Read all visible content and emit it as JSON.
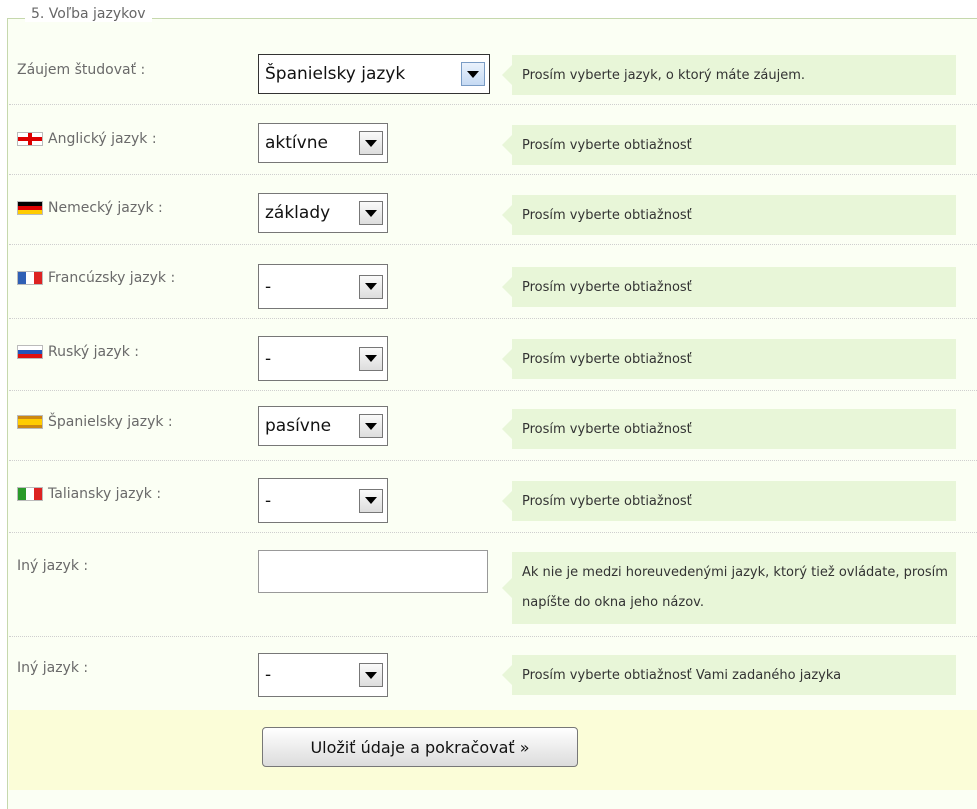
{
  "section_title": "5. Voľba jazykov",
  "interest": {
    "label": "Záujem študovať :",
    "value": "Španielsky jazyk",
    "hint": "Prosím vyberte jazyk, o ktorý máte záujem."
  },
  "languages": [
    {
      "label": "Anglický jazyk :",
      "flag": "uk-flag-icon",
      "value": "aktívne",
      "hint": "Prosím vyberte obtiažnosť"
    },
    {
      "label": "Nemecký jazyk :",
      "flag": "german-flag-icon",
      "value": "základy",
      "hint": "Prosím vyberte obtiažnosť"
    },
    {
      "label": "Francúzsky jazyk :",
      "flag": "french-flag-icon",
      "value": "-",
      "hint": "Prosím vyberte obtiažnosť"
    },
    {
      "label": "Ruský jazyk :",
      "flag": "russian-flag-icon",
      "value": "-",
      "hint": "Prosím vyberte obtiažnosť"
    },
    {
      "label": "Španielsky jazyk :",
      "flag": "spanish-flag-icon",
      "value": "pasívne",
      "hint": "Prosím vyberte obtiažnosť"
    },
    {
      "label": "Taliansky jazyk :",
      "flag": "italian-flag-icon",
      "value": "-",
      "hint": "Prosím vyberte obtiažnosť"
    }
  ],
  "other_language": {
    "label": "Iný jazyk :",
    "value": "",
    "hint": "Ak nie je medzi horeuvedenými jazyk, ktorý tiež ovládate, prosím napíšte do okna jeho názov."
  },
  "other_level": {
    "label": "Iný jazyk :",
    "value": "-",
    "hint": "Prosím vyberte obtiažnosť Vami zadaného jazyka"
  },
  "save_button": "Uložiť údaje a pokračovať »"
}
